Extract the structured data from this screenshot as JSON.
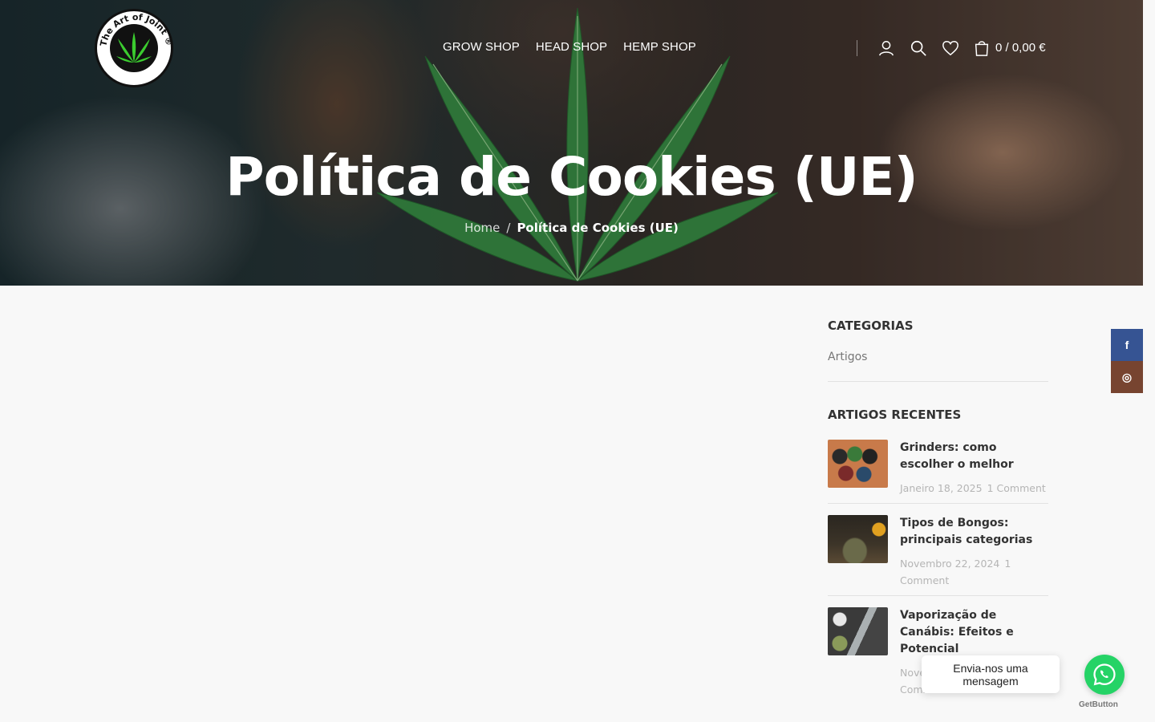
{
  "header": {
    "nav": [
      "GROW SHOP",
      "HEAD SHOP",
      "HEMP SHOP"
    ],
    "cart_amount": "0 / 0,00 €",
    "logo_text": "The Art of Joint ®",
    "logo_url_text": "www.theartofjoint.com"
  },
  "hero": {
    "title": "Política de Cookies (UE)",
    "breadcrumb_home": "Home",
    "breadcrumb_separator": "/",
    "breadcrumb_current": "Política de Cookies (UE)"
  },
  "sidebar": {
    "categories_title": "CATEGORIAS",
    "categories": [
      "Artigos"
    ],
    "recent_title": "ARTIGOS RECENTES",
    "posts": [
      {
        "title": "Grinders: como escolher o melhor",
        "date": "Janeiro 18, 2025",
        "comments": "1 Comment"
      },
      {
        "title": "Tipos de Bongos: principais categorias",
        "date": "Novembro 22, 2024",
        "comments": "1 Comment"
      },
      {
        "title": "Vaporização de Canábis: Efeitos e Potencial",
        "date": "Novembro 21, 2024",
        "comments": "1 Comment"
      }
    ]
  },
  "social": {
    "facebook": "f",
    "instagram": "◎"
  },
  "whatsapp": {
    "bubble": "Envia-nos uma mensagem",
    "brand": "GetButton"
  },
  "colors": {
    "facebook": "#365493",
    "instagram": "#774430",
    "whatsapp": "#25d366",
    "leaf": "#2f7a3a"
  }
}
